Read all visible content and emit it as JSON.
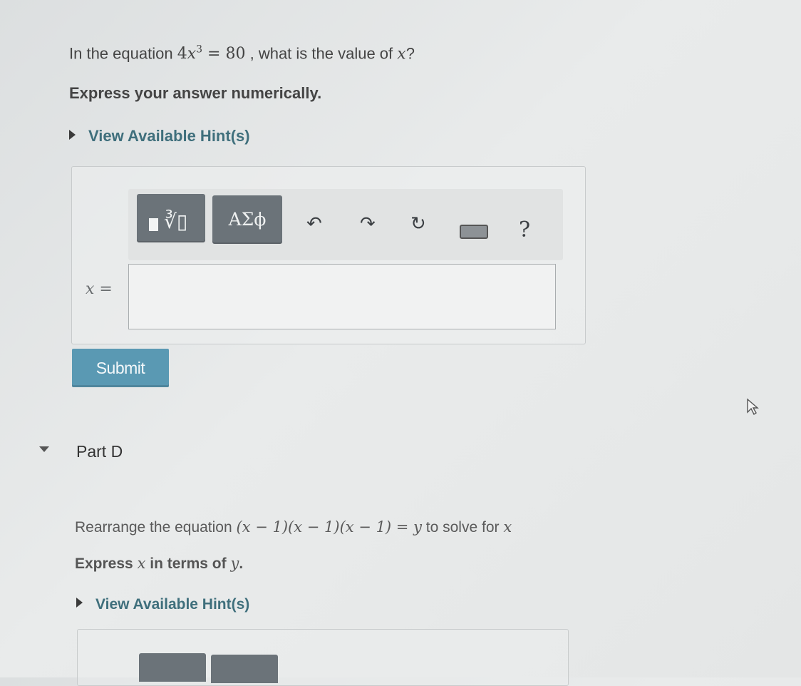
{
  "part_c": {
    "question_prefix": "In the equation",
    "eq_lhs": "4",
    "eq_var": "x",
    "eq_exp": "3",
    "eq_rhs": " = 80",
    "question_suffix": ", what is the value of",
    "question_var": "x",
    "question_end": "?",
    "instruction": "Express your answer numerically.",
    "hint_label": "View Available Hint(s)",
    "toolbar": {
      "greek_label": "ΑΣϕ",
      "undo_glyph": "↶",
      "redo_glyph": "↷",
      "reset_glyph": "↻",
      "help_label": "?"
    },
    "answer_label": "x =",
    "answer_value": "",
    "submit_label": "Submit"
  },
  "part_d": {
    "title": "Part D",
    "question_prefix": "Rearrange the equation",
    "equation": "(x − 1)(x − 1)(x − 1) = y",
    "question_suffix": "to solve for",
    "question_var": "x",
    "instruction_prefix": "Express",
    "instruction_var": "x",
    "instruction_mid": "in terms of",
    "instruction_var2": "y",
    "instruction_end": ".",
    "hint_label": "View Available Hint(s)"
  },
  "icons": {
    "templates": "templates-icon",
    "greek": "greek-letters-icon",
    "undo": "undo-icon",
    "redo": "redo-icon",
    "reset": "reset-icon",
    "keyboard": "keyboard-icon",
    "help": "help-icon",
    "cursor": "mouse-pointer-icon",
    "collapse": "caret-down-icon",
    "expand": "caret-right-icon"
  },
  "colors": {
    "submit_bg": "#5a99b3",
    "hint_text": "#3f6f7c",
    "toolbar_btn": "#6b7379"
  }
}
